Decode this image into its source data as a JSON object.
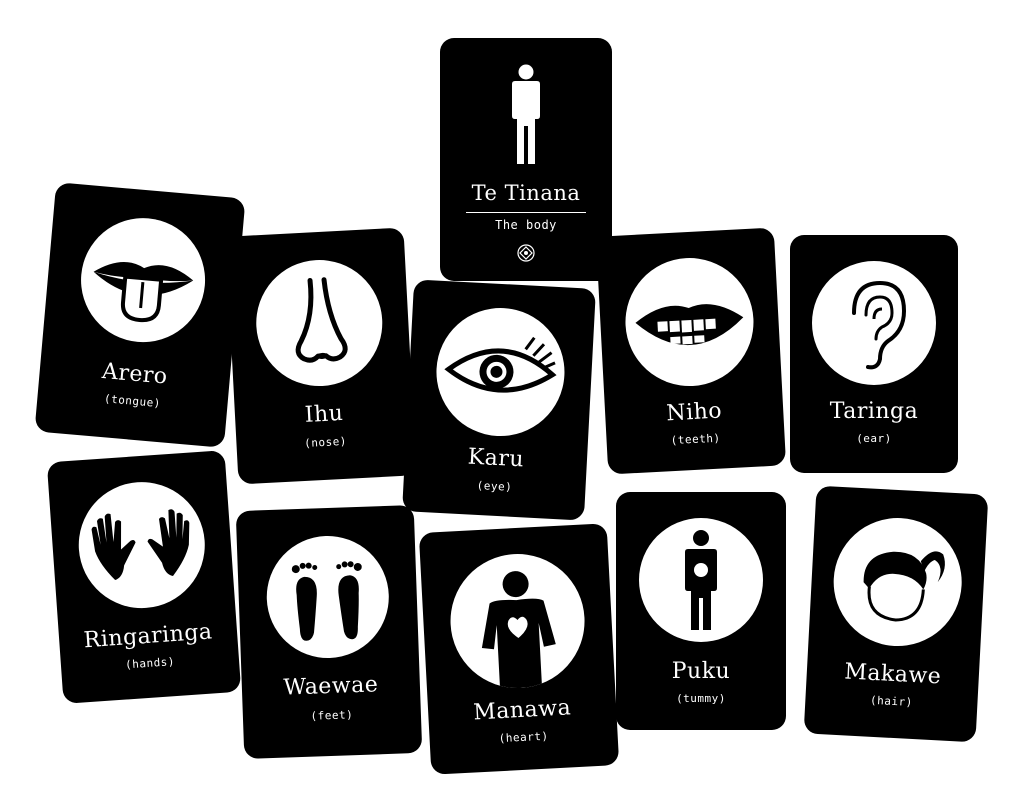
{
  "title_card": {
    "name": "Te Tinana",
    "translation": "The body"
  },
  "cards": [
    {
      "id": "arero",
      "name": "Arero",
      "translation": "(tongue)",
      "icon": "tongue-icon"
    },
    {
      "id": "ihu",
      "name": "Ihu",
      "translation": "(nose)",
      "icon": "nose-icon"
    },
    {
      "id": "karu",
      "name": "Karu",
      "translation": "(eye)",
      "icon": "eye-icon"
    },
    {
      "id": "niho",
      "name": "Niho",
      "translation": "(teeth)",
      "icon": "teeth-icon"
    },
    {
      "id": "taringa",
      "name": "Taringa",
      "translation": "(ear)",
      "icon": "ear-icon"
    },
    {
      "id": "ringaringa",
      "name": "Ringaringa",
      "translation": "(hands)",
      "icon": "hands-icon"
    },
    {
      "id": "waewae",
      "name": "Waewae",
      "translation": "(feet)",
      "icon": "feet-icon"
    },
    {
      "id": "manawa",
      "name": "Manawa",
      "translation": "(heart)",
      "icon": "heart-icon"
    },
    {
      "id": "puku",
      "name": "Puku",
      "translation": "(tummy)",
      "icon": "tummy-icon"
    },
    {
      "id": "makawe",
      "name": "Makawe",
      "translation": "(hair)",
      "icon": "hair-icon"
    }
  ],
  "colors": {
    "card": "#000000",
    "background": "#ffffff",
    "icon_circle": "#ffffff"
  }
}
